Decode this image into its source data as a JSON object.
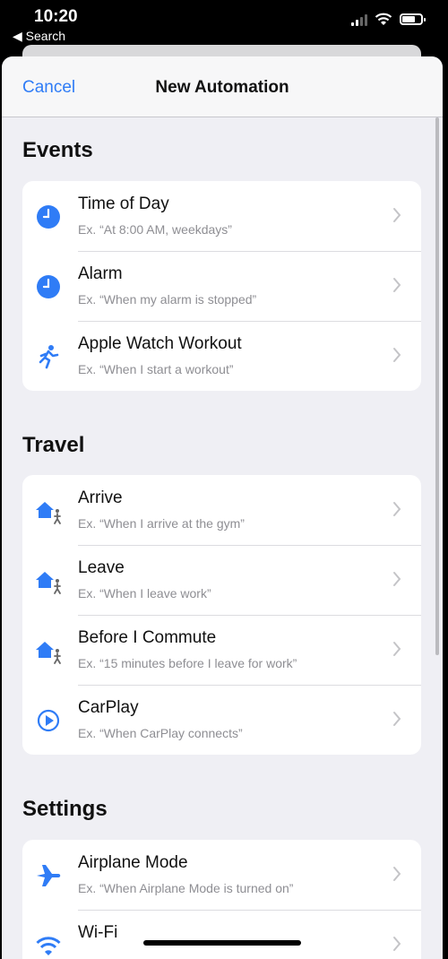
{
  "status_bar": {
    "time": "10:20",
    "back_app": "◀ Search"
  },
  "nav": {
    "cancel_label": "Cancel",
    "title": "New Automation"
  },
  "sections": {
    "events": {
      "header": "Events",
      "items": [
        {
          "title": "Time of Day",
          "subtitle": "Ex. “At 8:00 AM, weekdays”",
          "icon": "clock-icon"
        },
        {
          "title": "Alarm",
          "subtitle": "Ex. “When my alarm is stopped”",
          "icon": "clock-icon"
        },
        {
          "title": "Apple Watch Workout",
          "subtitle": "Ex. “When I start a workout”",
          "icon": "running-person-icon"
        }
      ]
    },
    "travel": {
      "header": "Travel",
      "items": [
        {
          "title": "Arrive",
          "subtitle": "Ex. “When I arrive at the gym”",
          "icon": "house-person-icon"
        },
        {
          "title": "Leave",
          "subtitle": "Ex. “When I leave work”",
          "icon": "house-person-icon"
        },
        {
          "title": "Before I Commute",
          "subtitle": "Ex. “15 minutes before I leave for work”",
          "icon": "house-person-icon"
        },
        {
          "title": "CarPlay",
          "subtitle": "Ex. “When CarPlay connects”",
          "icon": "carplay-icon"
        }
      ]
    },
    "settings": {
      "header": "Settings",
      "items": [
        {
          "title": "Airplane Mode",
          "subtitle": "Ex. “When Airplane Mode is turned on”",
          "icon": "airplane-icon"
        },
        {
          "title": "Wi-Fi",
          "subtitle": "",
          "icon": "wifi-icon"
        }
      ]
    }
  },
  "colors": {
    "accent": "#2f7cf6",
    "background": "#efeff4",
    "secondary_text": "#8e8e93"
  }
}
